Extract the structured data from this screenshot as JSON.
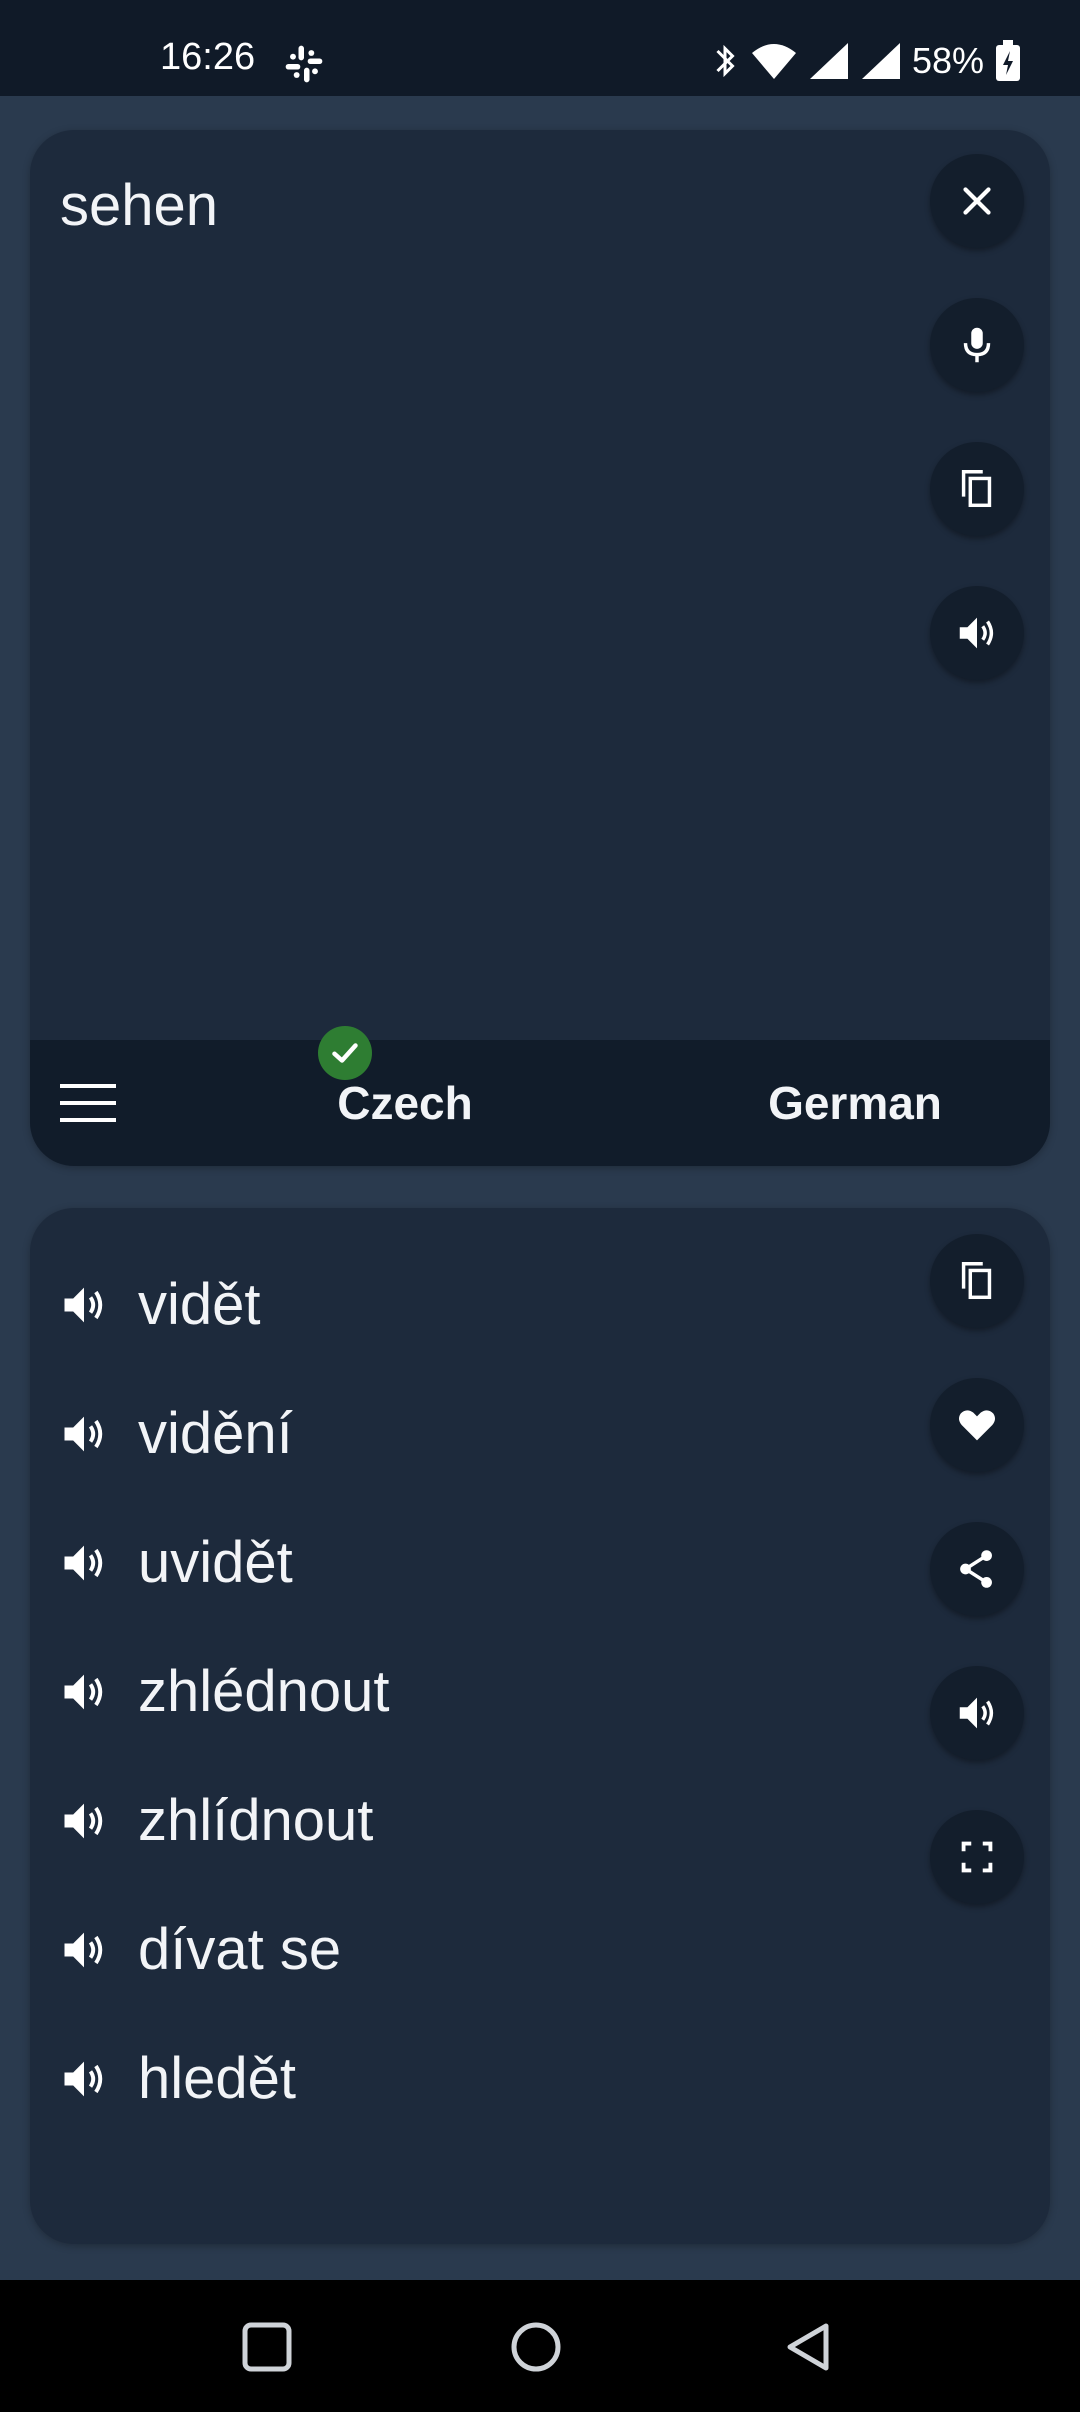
{
  "status_bar": {
    "time": "16:26",
    "battery": "58%"
  },
  "input": {
    "text": "sehen",
    "buttons": [
      "close-icon",
      "mic-icon",
      "copy-icon",
      "speaker-icon"
    ]
  },
  "languages": {
    "source": "Czech",
    "target": "German"
  },
  "results": {
    "items": [
      {
        "word": "vidět"
      },
      {
        "word": "vidění"
      },
      {
        "word": "uvidět"
      },
      {
        "word": "zhlédnout"
      },
      {
        "word": "zhlídnout"
      },
      {
        "word": "dívat se"
      },
      {
        "word": "hledět"
      }
    ],
    "buttons": [
      "copy-icon",
      "heart-icon",
      "share-icon",
      "speaker-icon",
      "fullscreen-icon"
    ]
  },
  "colors": {
    "background": "#2a3a4e",
    "card": "#1d2a3c",
    "lang_bar": "#111c2a",
    "button": "#131e2c",
    "check": "#2e7d32"
  }
}
